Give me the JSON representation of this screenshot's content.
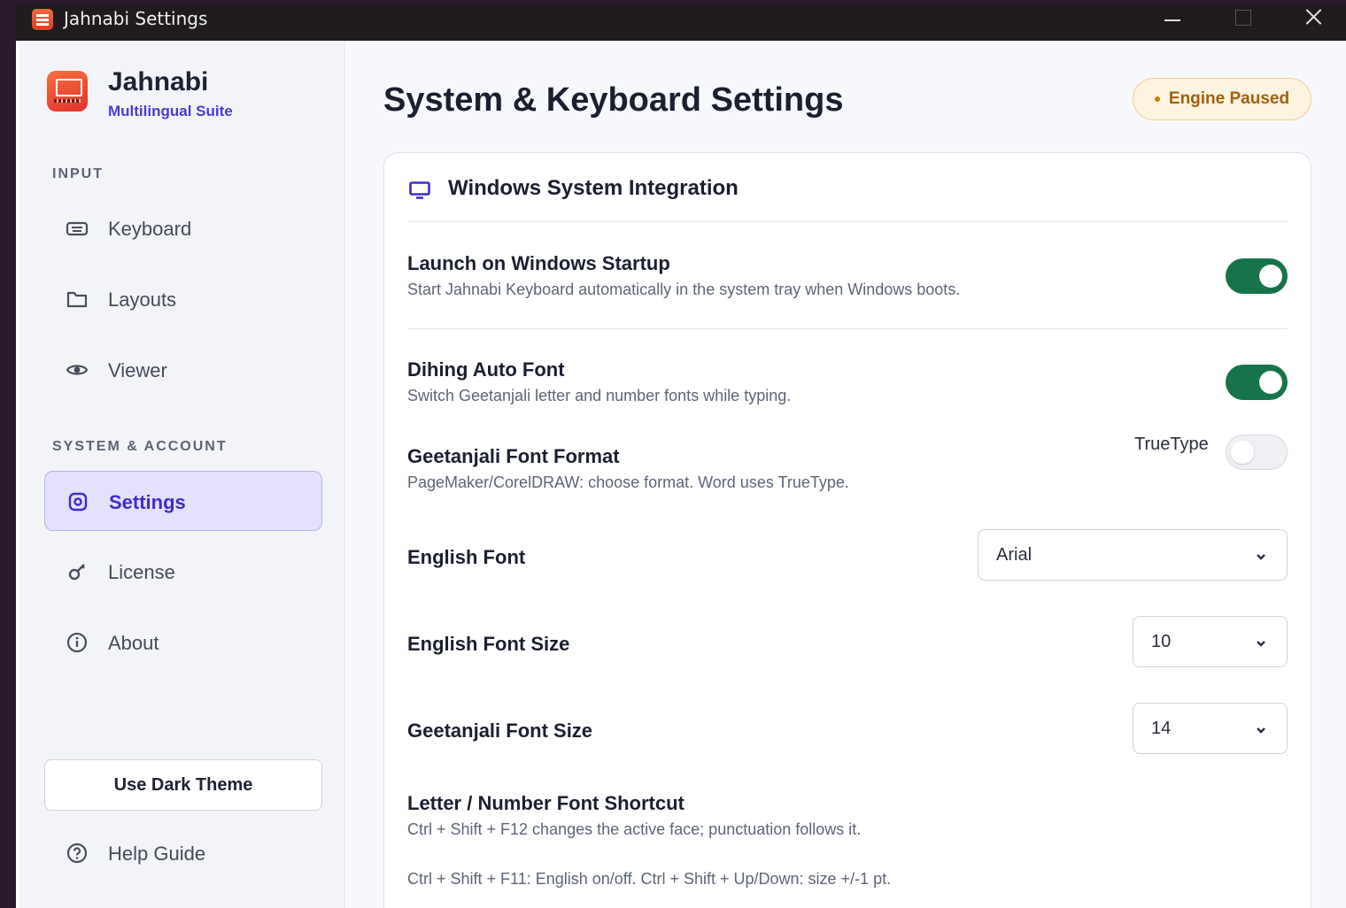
{
  "window": {
    "title": "Jahnabi Settings"
  },
  "sidebar": {
    "brand_name": "Jahnabi",
    "brand_subtitle": "Multilingual Suite",
    "sections": {
      "input": "INPUT",
      "system": "SYSTEM & ACCOUNT"
    },
    "items": [
      {
        "label": "Keyboard",
        "icon": "keyboard-icon"
      },
      {
        "label": "Layouts",
        "icon": "folder-icon"
      },
      {
        "label": "Viewer",
        "icon": "eye-icon"
      },
      {
        "label": "Settings",
        "icon": "gear-icon",
        "active": true
      },
      {
        "label": "License",
        "icon": "key-icon"
      },
      {
        "label": "About",
        "icon": "info-icon"
      }
    ],
    "theme_button": "Use Dark Theme",
    "help": {
      "label": "Help Guide",
      "icon": "help-circle-icon"
    }
  },
  "main": {
    "page_title": "System & Keyboard Settings",
    "status_badge": "Engine Paused",
    "card": {
      "title": "Windows System Integration",
      "icon": "monitor-icon",
      "settings": {
        "startup": {
          "title": "Launch on Windows Startup",
          "desc": "Start Jahnabi Keyboard automatically in the system tray when Windows boots.",
          "enabled": true
        },
        "auto_font": {
          "title": "Dihing Auto Font",
          "desc": "Switch Geetanjali letter and number fonts while typing.",
          "enabled": true
        },
        "font_format": {
          "title": "Geetanjali Font Format",
          "desc": "PageMaker/CorelDRAW: choose format. Word uses TrueType.",
          "toggle_label": "TrueType",
          "enabled": false
        },
        "english_font": {
          "title": "English Font",
          "value": "Arial"
        },
        "english_size": {
          "title": "English Font Size",
          "value": "10"
        },
        "geetanjali_size": {
          "title": "Geetanjali Font Size",
          "value": "14"
        },
        "shortcut": {
          "title": "Letter / Number Font Shortcut",
          "desc": "Ctrl + Shift + F12 changes the active face; punctuation follows it.",
          "note": "Ctrl + Shift + F11: English on/off. Ctrl + Shift + Up/Down: size +/-1 pt."
        }
      }
    }
  },
  "colors": {
    "accent": "#3d2dcf",
    "toggle_on": "#17744a",
    "badge_text": "#a2610c",
    "badge_bg": "#fdf3e1"
  }
}
